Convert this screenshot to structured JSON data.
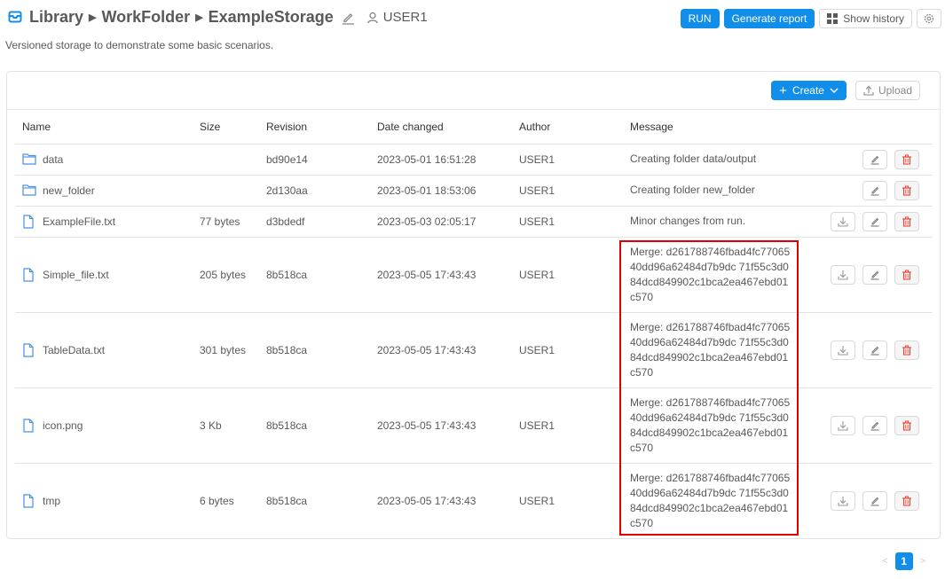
{
  "header": {
    "breadcrumb": [
      "Library",
      "WorkFolder",
      "ExampleStorage"
    ],
    "owner": "USER1",
    "description": "Versioned storage to demonstrate some basic scenarios.",
    "buttons": {
      "run": "RUN",
      "generate_report": "Generate report",
      "show_history": "Show history"
    }
  },
  "toolbar": {
    "create_label": "Create",
    "upload_label": "Upload"
  },
  "table": {
    "columns": [
      "Name",
      "Size",
      "Revision",
      "Date changed",
      "Author",
      "Message"
    ],
    "rows": [
      {
        "type": "folder",
        "name": "data",
        "size": "",
        "revision": "bd90e14",
        "date": "2023-05-01 16:51:28",
        "author": "USER1",
        "message": "Creating folder data/output"
      },
      {
        "type": "folder",
        "name": "new_folder",
        "size": "",
        "revision": "2d130aa",
        "date": "2023-05-01 18:53:06",
        "author": "USER1",
        "message": "Creating folder new_folder"
      },
      {
        "type": "file",
        "name": "ExampleFile.txt",
        "size": "77 bytes",
        "revision": "d3bdedf",
        "date": "2023-05-03 02:05:17",
        "author": "USER1",
        "message": "Minor changes from run."
      },
      {
        "type": "file",
        "name": "Simple_file.txt",
        "size": "205 bytes",
        "revision": "8b518ca",
        "date": "2023-05-05 17:43:43",
        "author": "USER1",
        "message": "Merge: d261788746fbad4fc7706540dd96a62484d7b9dc 71f55c3d084dcd849902c1bca2ea467ebd01c570"
      },
      {
        "type": "file",
        "name": "TableData.txt",
        "size": "301 bytes",
        "revision": "8b518ca",
        "date": "2023-05-05 17:43:43",
        "author": "USER1",
        "message": "Merge: d261788746fbad4fc7706540dd96a62484d7b9dc 71f55c3d084dcd849902c1bca2ea467ebd01c570"
      },
      {
        "type": "file",
        "name": "icon.png",
        "size": "3 Kb",
        "revision": "8b518ca",
        "date": "2023-05-05 17:43:43",
        "author": "USER1",
        "message": "Merge: d261788746fbad4fc7706540dd96a62484d7b9dc 71f55c3d084dcd849902c1bca2ea467ebd01c570"
      },
      {
        "type": "file",
        "name": "tmp",
        "size": "6 bytes",
        "revision": "8b518ca",
        "date": "2023-05-05 17:43:43",
        "author": "USER1",
        "message": "Merge: d261788746fbad4fc7706540dd96a62484d7b9dc 71f55c3d084dcd849902c1bca2ea467ebd01c570"
      }
    ]
  },
  "pagination": {
    "current_page": "1"
  },
  "colors": {
    "primary": "#108ee9",
    "danger": "#f04134",
    "highlight": "#e00000"
  }
}
